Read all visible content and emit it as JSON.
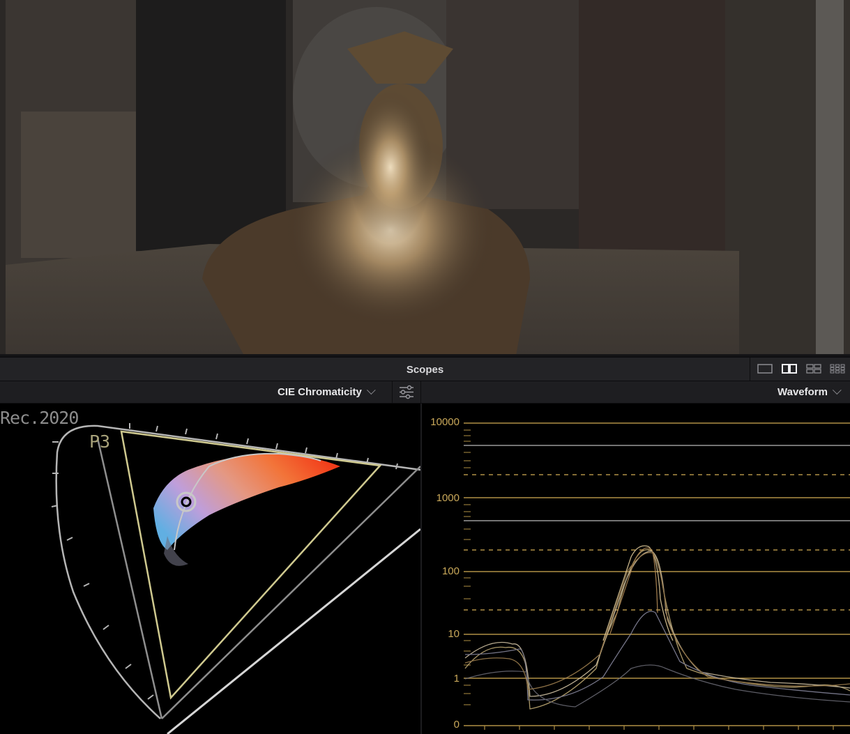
{
  "scopes": {
    "title": "Scopes",
    "layout_options": [
      "single-view-icon",
      "dual-view-icon",
      "quad-view-icon",
      "grid-view-icon"
    ]
  },
  "left_scope": {
    "selector_label": "CIE Chromaticity",
    "gamut_labels": {
      "outer": "Rec.2020",
      "inner": "P3"
    }
  },
  "right_scope": {
    "selector_label": "Waveform",
    "scale_labels": [
      "10000",
      "1000",
      "100",
      "10",
      "1",
      "0"
    ]
  },
  "colors": {
    "accent_gold": "#c9a85a",
    "p3_triangle": "#cfc98f",
    "rec2020_outline": "#b5b5b5"
  }
}
